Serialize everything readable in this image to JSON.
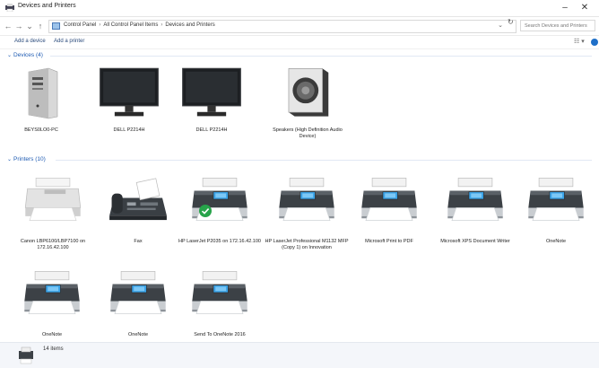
{
  "window": {
    "title": "Devices and Printers",
    "controls": {
      "minimize": "–",
      "close": "✕"
    }
  },
  "address": {
    "crumbs": [
      "Control Panel",
      "All Control Panel Items",
      "Devices and Printers"
    ],
    "search_placeholder": "Search Devices and Printers",
    "dropdown": "⌄",
    "refresh": "↻"
  },
  "toolbar": {
    "add_device": "Add a device",
    "add_printer": "Add a printer"
  },
  "sections": {
    "devices": "Devices (4)",
    "printers": "Printers (10)"
  },
  "devices": [
    {
      "label": "BEYS0LO0-PC",
      "icon": "desktop-tower-icon"
    },
    {
      "label": "DELL P2214H",
      "icon": "monitor-icon"
    },
    {
      "label": "DELL P2214H",
      "icon": "monitor-icon"
    },
    {
      "label": "Speakers (High Definition Audio\nDevice)",
      "icon": "speaker-icon"
    }
  ],
  "printers": [
    {
      "label": "Canon LBP6100/LBP7100 on\n172.16.42.100",
      "icon": "printer-icon"
    },
    {
      "label": "Fax",
      "icon": "fax-icon"
    },
    {
      "label": "HP LaserJet P2035 on 172.16.42.100",
      "icon": "printer-icon",
      "default": true
    },
    {
      "label": "HP LaserJet Professional M1132 MFP\n(Copy 1) on Innovation",
      "icon": "printer-icon"
    },
    {
      "label": "Microsoft Print to PDF",
      "icon": "printer-icon"
    },
    {
      "label": "Microsoft XPS Document Writer",
      "icon": "printer-icon"
    },
    {
      "label": "OneNote",
      "icon": "printer-icon"
    },
    {
      "label": "OneNote",
      "icon": "printer-icon"
    },
    {
      "label": "OneNote",
      "icon": "printer-icon"
    },
    {
      "label": "Send To OneNote 2016",
      "icon": "printer-icon"
    }
  ],
  "status": {
    "count": "14 items"
  },
  "colors": {
    "accent": "#1e5bb3",
    "default_check": "#27a34a"
  }
}
